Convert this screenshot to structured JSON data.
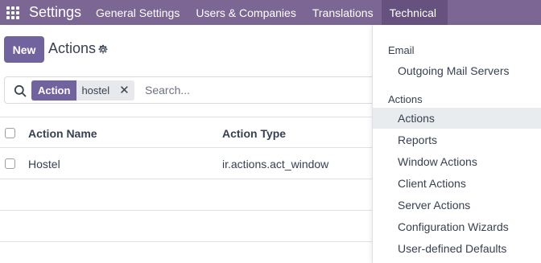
{
  "navbar": {
    "app_name": "Settings",
    "menus": [
      {
        "label": "General Settings"
      },
      {
        "label": "Users & Companies"
      },
      {
        "label": "Translations"
      },
      {
        "label": "Technical"
      }
    ],
    "colors": {
      "bar": "#7b6694",
      "active": "#67527f"
    }
  },
  "control_panel": {
    "new_label": "New",
    "title": "Actions"
  },
  "search": {
    "facet_label": "Action",
    "facet_value": "hostel",
    "placeholder": "Search..."
  },
  "table": {
    "columns": [
      "Action Name",
      "Action Type"
    ],
    "rows": [
      {
        "name": "Hostel",
        "type": "ir.actions.act_window"
      }
    ]
  },
  "dropdown": {
    "sections": [
      {
        "header": "Email",
        "items": [
          "Outgoing Mail Servers"
        ]
      },
      {
        "header": "Actions",
        "items": [
          "Actions",
          "Reports",
          "Window Actions",
          "Client Actions",
          "Server Actions",
          "Configuration Wizards",
          "User-defined Defaults"
        ]
      }
    ],
    "active_item": "Actions"
  }
}
